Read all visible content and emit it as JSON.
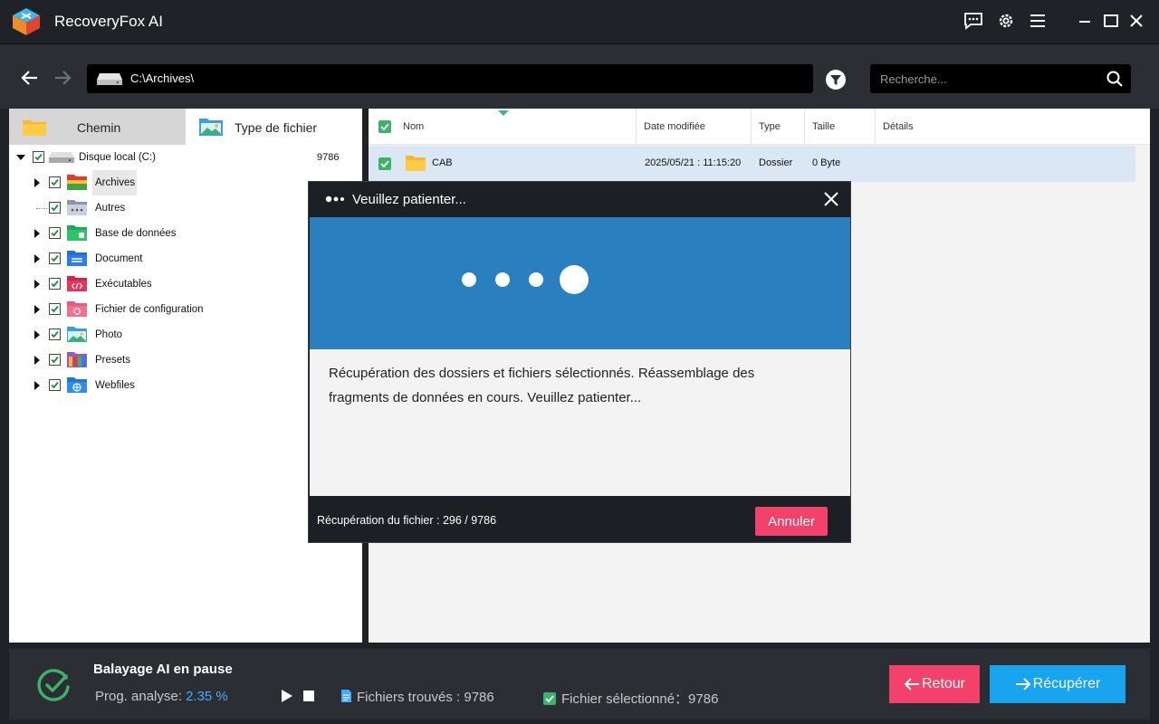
{
  "app": {
    "title": "RecoveryFox AI"
  },
  "address": {
    "path": "C:\\Archives\\",
    "search_placeholder": "Recherche..."
  },
  "tabs": {
    "path_label": "Chemin",
    "type_label": "Type de fichier"
  },
  "tree": {
    "root": {
      "label": "Disque local (C:)",
      "count": "9786"
    },
    "items": [
      {
        "label": "Archives",
        "icon": "archive-folder-icon",
        "color": "#e53935"
      },
      {
        "label": "Autres",
        "icon": "other-folder-icon",
        "color": "#8a93a8"
      },
      {
        "label": "Base de données",
        "icon": "database-folder-icon",
        "color": "#2ec26a"
      },
      {
        "label": "Document",
        "icon": "document-folder-icon",
        "color": "#2b7de9"
      },
      {
        "label": "Exécutables",
        "icon": "executable-folder-icon",
        "color": "#e8335a"
      },
      {
        "label": "Fichier de configuration",
        "icon": "config-folder-icon",
        "color": "#f0708e"
      },
      {
        "label": "Photo",
        "icon": "photo-folder-icon",
        "color": "#3aa0d8"
      },
      {
        "label": "Presets",
        "icon": "presets-folder-icon",
        "color": "#8e5cc9"
      },
      {
        "label": "Webfiles",
        "icon": "web-folder-icon",
        "color": "#2f8ee8"
      }
    ]
  },
  "list": {
    "columns": {
      "name": "Nom",
      "date": "Date modifiée",
      "type": "Type",
      "size": "Taille",
      "details": "Détails"
    },
    "rows": [
      {
        "name": "CAB",
        "date": "2025/05/21 : 11:15:20",
        "type": "Dossier",
        "size": "0 Byte",
        "details": ""
      }
    ]
  },
  "modal": {
    "title": "Veuillez patienter...",
    "message": "Récupération des dossiers et fichiers sélectionnés. Réassemblage des fragments de données en cours. Veuillez patienter...",
    "progress": "Récupération du fichier : 296 / 9786",
    "cancel_label": "Annuler"
  },
  "status": {
    "title": "Balayage AI en pause",
    "progress_label": "Prog. analyse:",
    "progress_value": "2.35 %",
    "files_found": "Fichiers trouvés : 9786",
    "files_selected": "Fichier sélectionné：9786"
  },
  "buttons": {
    "back_label": "Retour",
    "recover_label": "Récupérer"
  },
  "colors": {
    "accent": "#19a4f0",
    "danger": "#f2416b",
    "banner": "#2a80bf",
    "success": "#3bb36b"
  }
}
